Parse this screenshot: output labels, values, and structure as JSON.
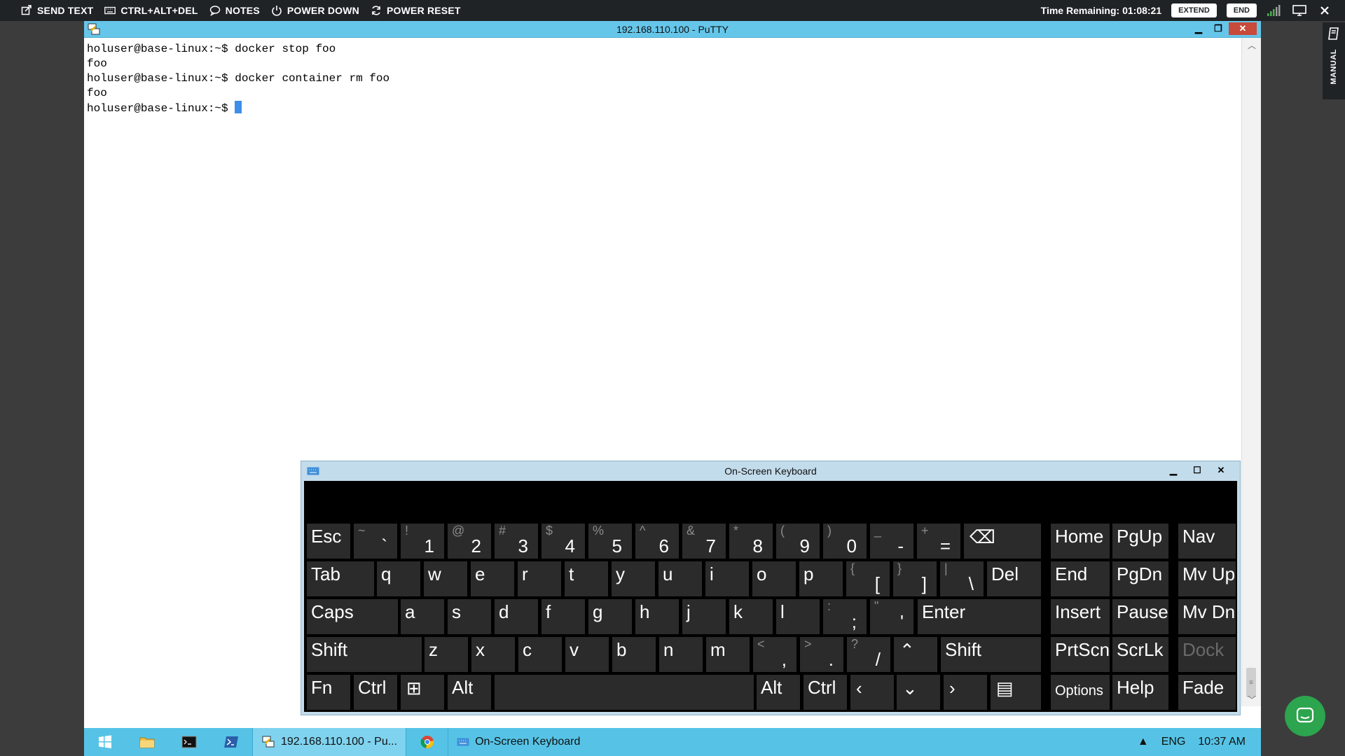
{
  "toolbar": {
    "send_text": "SEND TEXT",
    "ctrl_alt_del": "CTRL+ALT+DEL",
    "notes": "NOTES",
    "power_down": "POWER DOWN",
    "power_reset": "POWER RESET",
    "time_remaining": "Time Remaining: 01:08:21",
    "extend": "EXTEND",
    "end": "END"
  },
  "manual": {
    "label": "MANUAL"
  },
  "putty": {
    "title": "192.168.110.100 - PuTTY",
    "lines": [
      "holuser@base-linux:~$ docker stop foo",
      "foo",
      "holuser@base-linux:~$ docker container rm foo",
      "foo"
    ],
    "prompt": "holuser@base-linux:~$ "
  },
  "osk": {
    "title": "On-Screen Keyboard",
    "keys": {
      "esc": "Esc",
      "tab": "Tab",
      "caps": "Caps",
      "shift": "Shift",
      "fn": "Fn",
      "ctrl": "Ctrl",
      "alt": "Alt",
      "enter": "Enter",
      "del": "Del",
      "home": "Home",
      "pgup": "PgUp",
      "nav": "Nav",
      "end": "End",
      "pgdn": "PgDn",
      "mvup": "Mv Up",
      "insert": "Insert",
      "pause": "Pause",
      "mvdn": "Mv Dn",
      "prtscn": "PrtScn",
      "scrlk": "ScrLk",
      "dock": "Dock",
      "options": "Options",
      "help": "Help",
      "fade": "Fade",
      "num": [
        {
          "s": "~",
          "m": "`"
        },
        {
          "s": "!",
          "m": "1"
        },
        {
          "s": "@",
          "m": "2"
        },
        {
          "s": "#",
          "m": "3"
        },
        {
          "s": "$",
          "m": "4"
        },
        {
          "s": "%",
          "m": "5"
        },
        {
          "s": "^",
          "m": "6"
        },
        {
          "s": "&",
          "m": "7"
        },
        {
          "s": "*",
          "m": "8"
        },
        {
          "s": "(",
          "m": "9"
        },
        {
          "s": ")",
          "m": "0"
        },
        {
          "s": "_",
          "m": "-"
        },
        {
          "s": "+",
          "m": "="
        }
      ],
      "row_q": [
        "q",
        "w",
        "e",
        "r",
        "t",
        "y",
        "u",
        "i",
        "o",
        "p"
      ],
      "row_q_sym": [
        {
          "s": "{",
          "m": "["
        },
        {
          "s": "}",
          "m": "]"
        },
        {
          "s": "|",
          "m": "\\"
        }
      ],
      "row_a": [
        "a",
        "s",
        "d",
        "f",
        "g",
        "h",
        "j",
        "k",
        "l"
      ],
      "row_a_sym": [
        {
          "s": ":",
          "m": ";"
        },
        {
          "s": "\"",
          "m": "'"
        }
      ],
      "row_z": [
        "z",
        "x",
        "c",
        "v",
        "b",
        "n",
        "m"
      ],
      "row_z_sym": [
        {
          "s": "<",
          "m": ","
        },
        {
          "s": ">",
          "m": "."
        },
        {
          "s": "?",
          "m": "/"
        }
      ]
    }
  },
  "taskbar": {
    "putty_label": "192.168.110.100 - Pu...",
    "osk_label": "On-Screen Keyboard",
    "language": "ENG",
    "clock": "10:37 AM"
  }
}
